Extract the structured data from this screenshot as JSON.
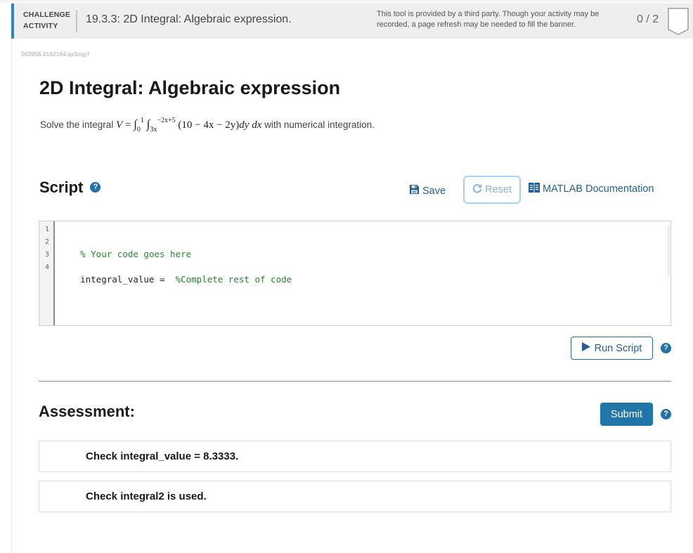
{
  "banner": {
    "label_line1": "CHALLENGE",
    "label_line2": "ACTIVITY",
    "title": "19.3.3: 2D Integral: Algebraic expression.",
    "note": "This tool is provided by a third party. Though your activity may be recorded, a page refresh may be needed to fill the banner.",
    "score": "0 / 2",
    "accent_color": "#2b86c8"
  },
  "activity_id": "563956.4192164.qx3zqy7",
  "page_title": "2D Integral: Algebraic expression",
  "problem": {
    "prefix": "Solve the integral",
    "math": {
      "lhs": "V",
      "eq": "=",
      "outer_upper": "1",
      "outer_lower": "0",
      "inner_upper": "−2x+5",
      "inner_lower": "3x",
      "integrand": "(10 − 4x − 2y)",
      "differentials": "dy dx"
    },
    "suffix": "with numerical integration."
  },
  "script": {
    "title": "Script",
    "help_icon": "?",
    "save_label": "Save",
    "reset_label": "Reset",
    "doc_label": "MATLAB Documentation",
    "code_lines": [
      {
        "num": "1",
        "code": "",
        "comment": ""
      },
      {
        "num": "2",
        "code": "",
        "comment": "% Your code goes here"
      },
      {
        "num": "3",
        "code": "",
        "comment": ""
      },
      {
        "num": "4",
        "code": "integral_value =  ",
        "comment": "%Complete rest of code"
      }
    ],
    "run_label": "Run Script"
  },
  "assessment": {
    "title": "Assessment:",
    "submit_label": "Submit",
    "checks": [
      "Check integral_value = 8.3333.",
      "Check integral2 is used."
    ]
  }
}
